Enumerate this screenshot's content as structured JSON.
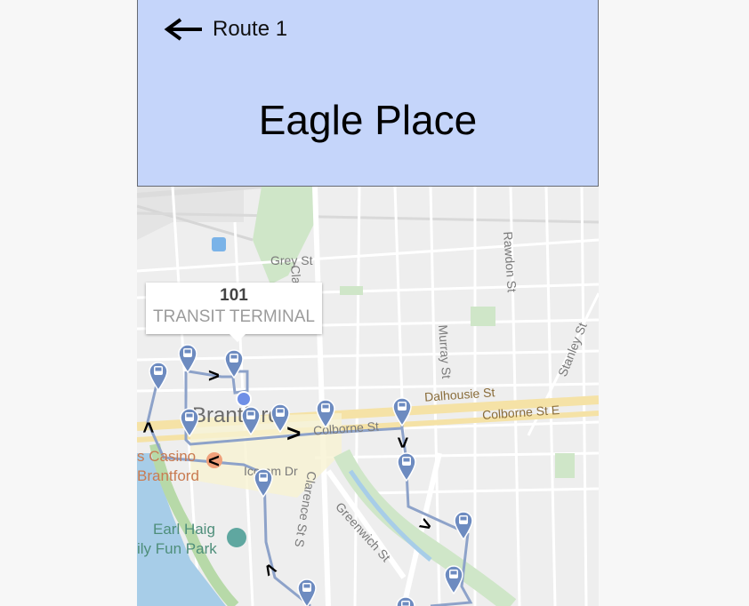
{
  "header": {
    "back_icon": "arrow-left-icon",
    "route_label": "Route 1",
    "stop_name": "Eagle Place",
    "background": "#c5d5fa"
  },
  "map": {
    "popup": {
      "stop_number": "101",
      "stop_name": "TRANSIT TERMINAL"
    },
    "streets": {
      "grey": "Grey St",
      "clarence": "Clarence St",
      "rawdon": "Rawdon St",
      "murray": "Murray St",
      "stanley": "Stanley St",
      "dalhousie": "Dalhousie St",
      "colborne_e": "Colborne St E",
      "colborne": "Colborne St",
      "icomm": "Icomm Dr",
      "clarence_s": "Clarence St S",
      "greenwich": "Greenwich St"
    },
    "places": {
      "city": "Brantford",
      "casino_1": "s Casino",
      "casino_2": "Brantford",
      "park_1": "Earl Haig",
      "park_2": "ily Fun Park"
    },
    "route_color": "#8da2c9",
    "marker_color": "#6d8bc0",
    "marker_icon": "bus-stop-icon"
  }
}
